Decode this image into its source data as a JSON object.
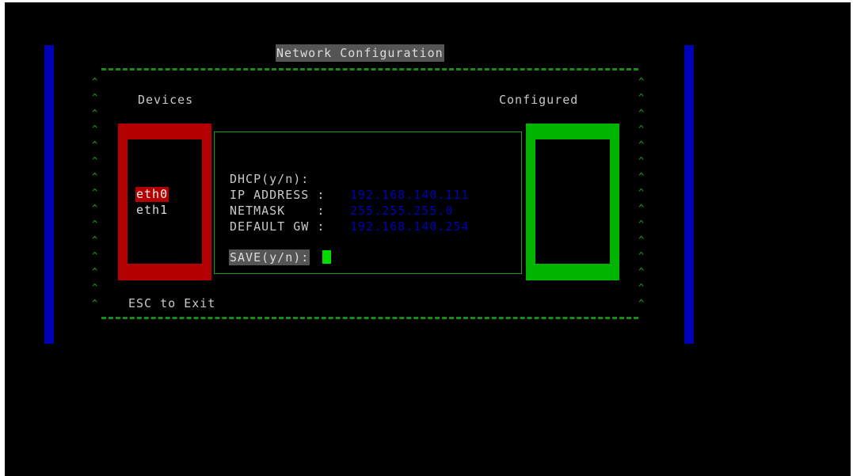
{
  "window": {
    "title": "Network Configuration"
  },
  "headings": {
    "devices": "Devices",
    "configured": "Configured"
  },
  "devices": {
    "items": [
      {
        "label": "eth0",
        "selected": true
      },
      {
        "label": "eth1",
        "selected": false
      }
    ]
  },
  "form": {
    "dhcp_label": "DHCP(y/n):",
    "dhcp_value": "",
    "ip_label": "IP ADDRESS :",
    "ip_value": "192.168.140.111",
    "netmask_label": "NETMASK    :",
    "netmask_value": "255.255.255.0",
    "gateway_label": "DEFAULT GW :",
    "gateway_value": "192.168.140.254",
    "save_label": "SAVE(y/n):"
  },
  "footer": {
    "exit_hint": "ESC to Exit"
  },
  "border": {
    "rule": "======================================================================",
    "caret": "^"
  },
  "colors": {
    "background": "#000000",
    "side_bar": "#0000b4",
    "devices_panel": "#b40000",
    "configured_panel": "#00b400",
    "border_green": "#1a9e1a",
    "value_blue": "#0000b4",
    "cursor": "#00dc00",
    "title_bg": "#555555"
  }
}
